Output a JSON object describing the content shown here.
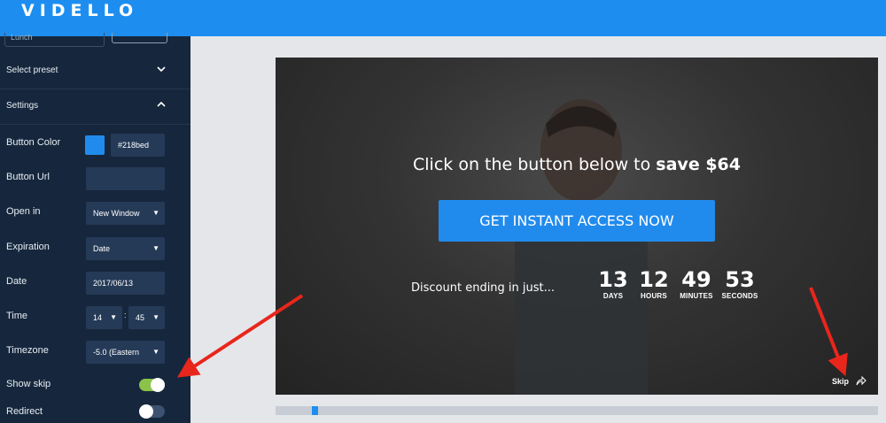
{
  "app": {
    "title": "VIDELLO"
  },
  "sidebar": {
    "top_input_value": "Lunch",
    "sections": {
      "preset_label": "Select preset",
      "settings_label": "Settings"
    },
    "fields": {
      "button_color": {
        "label": "Button Color",
        "value": "#218bed",
        "swatch": "#218bed"
      },
      "button_url": {
        "label": "Button Url",
        "value": ""
      },
      "open_in": {
        "label": "Open in",
        "value": "New Window"
      },
      "expiration": {
        "label": "Expiration",
        "value": "Date"
      },
      "date": {
        "label": "Date",
        "value": "2017/06/13"
      },
      "time": {
        "label": "Time",
        "hour": "14",
        "separator": ":",
        "minute": "45"
      },
      "timezone": {
        "label": "Timezone",
        "value": "-5.0 (Eastern"
      },
      "show_skip": {
        "label": "Show skip",
        "on": true
      },
      "redirect": {
        "label": "Redirect",
        "on": false
      }
    }
  },
  "video": {
    "cta_text": "Click on the button below to ",
    "cta_bold": "save $64",
    "button_label": "GET INSTANT ACCESS NOW",
    "discount_text": "Discount ending in just...",
    "countdown": [
      {
        "num": "13",
        "unit": "DAYS"
      },
      {
        "num": "12",
        "unit": "HOURS"
      },
      {
        "num": "49",
        "unit": "MINUTES"
      },
      {
        "num": "53",
        "unit": "SECONDS"
      }
    ],
    "skip_label": "Skip",
    "progress": 0.06
  },
  "colors": {
    "accent": "#218bed",
    "toggle_on": "#8bc34a",
    "annotation": "#e8261c"
  }
}
